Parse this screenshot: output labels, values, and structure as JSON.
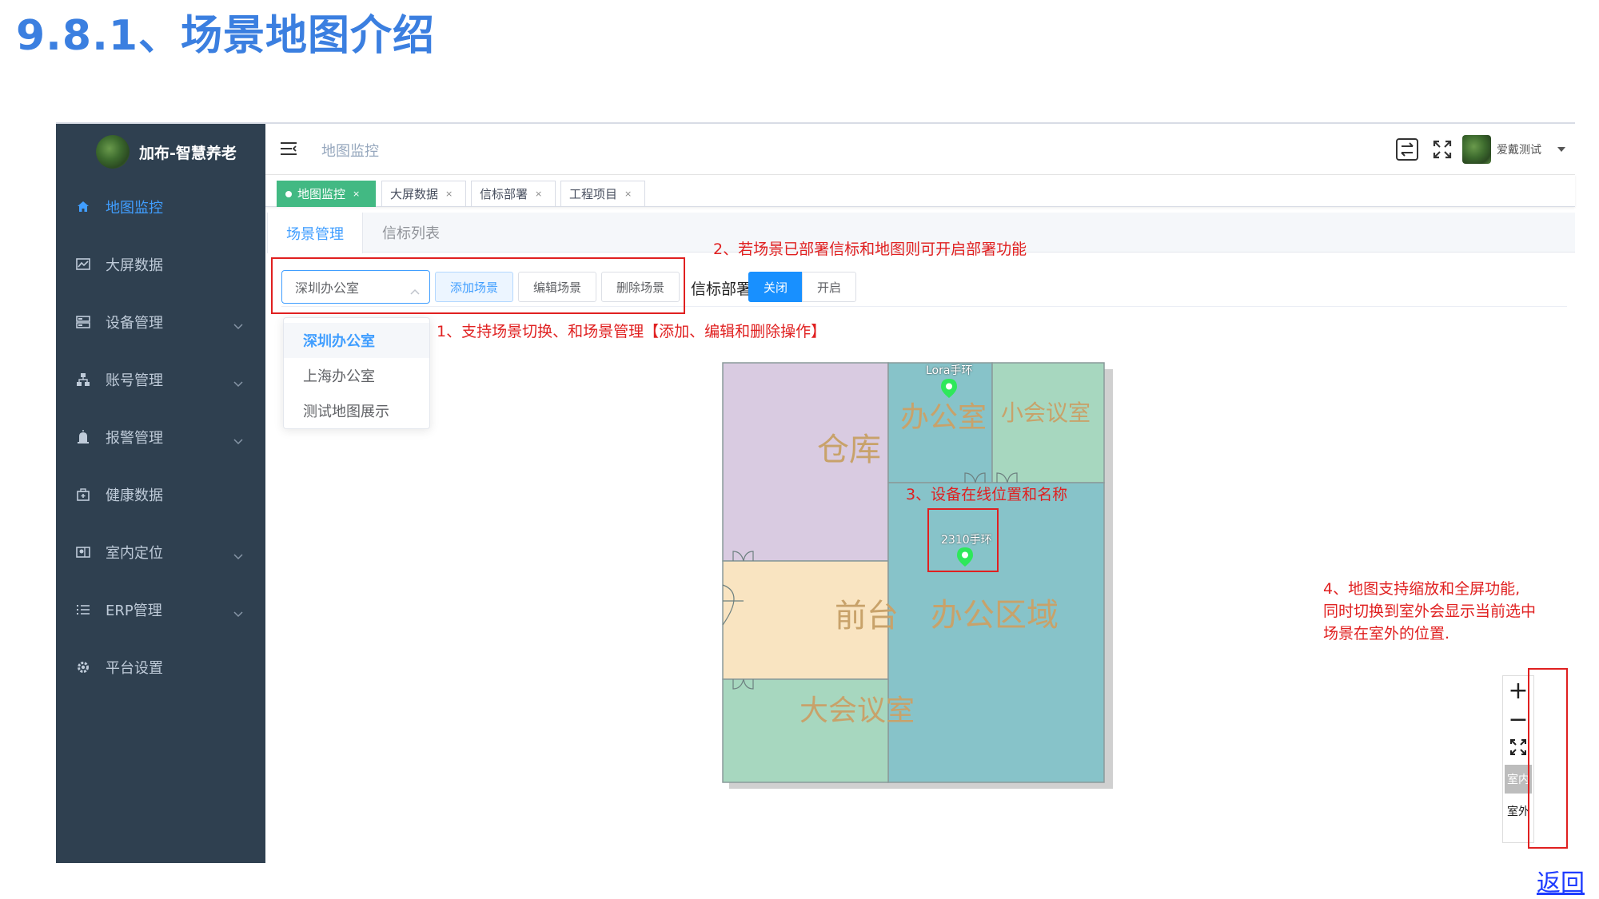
{
  "heading": "9.8.1、场景地图介绍",
  "sidebar": {
    "logo_text": "加布-智慧养老",
    "items": [
      {
        "label": "地图监控",
        "icon": "home-icon",
        "active": true,
        "expandable": false
      },
      {
        "label": "大屏数据",
        "icon": "chart-icon",
        "active": false,
        "expandable": false
      },
      {
        "label": "设备管理",
        "icon": "server-icon",
        "active": false,
        "expandable": true
      },
      {
        "label": "账号管理",
        "icon": "tree-icon",
        "active": false,
        "expandable": true
      },
      {
        "label": "报警管理",
        "icon": "alarm-icon",
        "active": false,
        "expandable": true
      },
      {
        "label": "健康数据",
        "icon": "health-icon",
        "active": false,
        "expandable": false
      },
      {
        "label": "室内定位",
        "icon": "map-icon",
        "active": false,
        "expandable": true
      },
      {
        "label": "ERP管理",
        "icon": "list-icon",
        "active": false,
        "expandable": true
      },
      {
        "label": "平台设置",
        "icon": "gear-icon",
        "active": false,
        "expandable": false
      }
    ]
  },
  "navbar": {
    "breadcrumb": "地图监控",
    "username": "爱戴测试"
  },
  "tags": [
    {
      "label": "地图监控",
      "active": true
    },
    {
      "label": "大屏数据",
      "active": false
    },
    {
      "label": "信标部署",
      "active": false
    },
    {
      "label": "工程项目",
      "active": false
    }
  ],
  "tabs": [
    {
      "label": "场景管理",
      "active": true
    },
    {
      "label": "信标列表",
      "active": false
    }
  ],
  "toolbar": {
    "scene_select_value": "深圳办公室",
    "add_scene": "添加场景",
    "edit_scene": "编辑场景",
    "delete_scene": "删除场景",
    "beacon_deploy_label": "信标部署",
    "toggle_off": "关闭",
    "toggle_on": "开启"
  },
  "scene_options": [
    "深圳办公室",
    "上海办公室",
    "测试地图展示"
  ],
  "map": {
    "rooms": {
      "warehouse": "仓库",
      "office": "办公室",
      "small_meeting": "小会议室",
      "reception": "前台",
      "office_area": "办公区域",
      "large_meeting": "大会议室"
    },
    "devices": [
      "Lora手环",
      "2310手环"
    ],
    "colors": {
      "warehouse": "#d9cbe1",
      "office": "#87c3c9",
      "small_meeting": "#a7d7bf",
      "reception": "#f9e4c1",
      "office_area": "#87c3c9",
      "large_meeting": "#a7d7bf",
      "pin": "#2ee85a"
    }
  },
  "map_controls": {
    "zoom_in": "+",
    "zoom_out": "−",
    "indoor": "室内",
    "outdoor": "室外"
  },
  "annotations": {
    "a1": "1、支持场景切换、和场景管理【添加、编辑和删除操作】",
    "a2": "2、若场景已部署信标和地图则可开启部署功能",
    "a3": "3、设备在线位置和名称",
    "a4_line1": "4、地图支持缩放和全屏功能,",
    "a4_line2": "同时切换到室外会显示当前选中",
    "a4_line3": "场景在室外的位置."
  },
  "back_link": "返回"
}
